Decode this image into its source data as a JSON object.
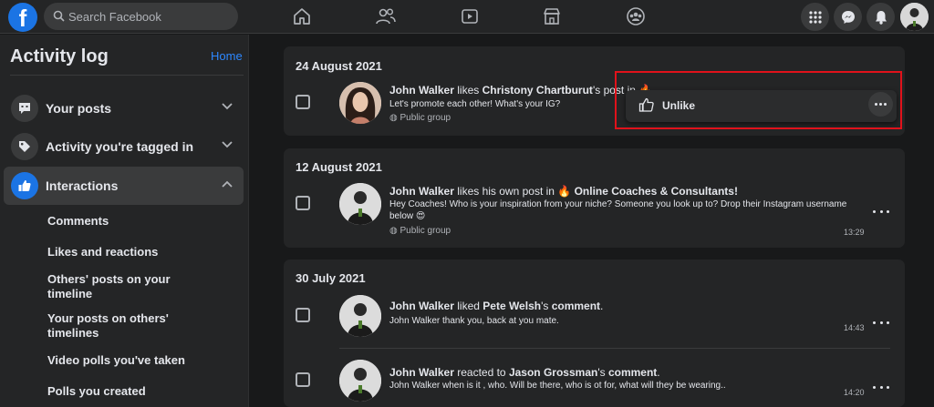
{
  "topbar": {
    "logo": "f",
    "search_placeholder": "Search Facebook",
    "nav_icons": [
      "home-icon",
      "friends-icon",
      "watch-icon",
      "marketplace-icon",
      "groups-icon"
    ],
    "right_icons": [
      "menu-grid-icon",
      "messenger-icon",
      "notifications-icon"
    ]
  },
  "sidebar": {
    "title": "Activity log",
    "home_link": "Home",
    "items": [
      {
        "label": "Your posts",
        "icon": "speech-bubble-icon"
      },
      {
        "label": "Activity you're tagged in",
        "icon": "tag-icon"
      },
      {
        "label": "Interactions",
        "icon": "thumbs-up-icon"
      }
    ],
    "sub_items": [
      "Comments",
      "Likes and reactions",
      "Others' posts on your timeline",
      "Your posts on others' timelines",
      "Video polls you've taken",
      "Polls you created"
    ]
  },
  "cards": [
    {
      "date": "24 August 2021",
      "entries": [
        {
          "actor": "John Walker",
          "verb": " likes ",
          "target": "Christony Chartburut",
          "suffix": "'s post in 🔥",
          "snippet": "Let's promote each other! What's your IG?",
          "scope": "Public group"
        }
      ]
    },
    {
      "date": "12 August 2021",
      "entries": [
        {
          "actor": "John Walker",
          "verb": " likes his own post in 🔥 ",
          "target": "Online Coaches & Consultants!",
          "snippet": "Hey Coaches! Who is your inspiration from your niche? Someone you look up to? Drop their Instagram username",
          "snippet2": "below 😍",
          "scope": "Public group",
          "time": "13:29"
        }
      ]
    },
    {
      "date": "30 July 2021",
      "entries": [
        {
          "actor": "John Walker",
          "verb": " liked ",
          "target": "Pete Welsh",
          "mid": "'s ",
          "target2": "comment",
          "end": ".",
          "snippet": "John Walker thank you, back at you mate.",
          "time": "14:43"
        },
        {
          "actor": "John Walker",
          "verb": " reacted to ",
          "target": "Jason Grossman",
          "mid": "'s ",
          "target2": "comment",
          "end": ".",
          "snippet": "John Walker when is it , who. Will be there, who is ot for, what will they be wearing..",
          "time": "14:20"
        }
      ]
    }
  ],
  "popup": {
    "label": "Unlike",
    "icon": "thumbs-up-outline-icon",
    "highlight_color": "#e0121b"
  },
  "colors": {
    "background": "#18191a",
    "surface": "#242526",
    "accent": "#1b74e4",
    "link": "#2d88ff"
  }
}
